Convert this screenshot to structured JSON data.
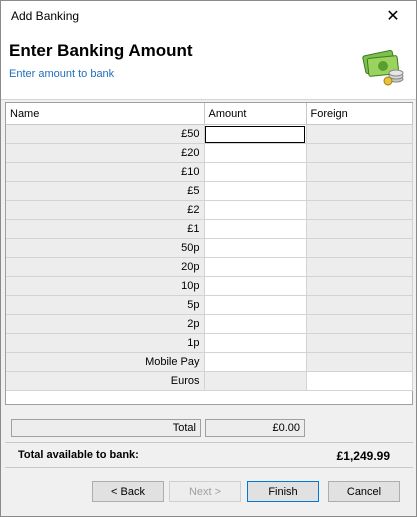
{
  "window": {
    "title": "Add Banking",
    "close_glyph": "✕"
  },
  "header": {
    "title": "Enter Banking Amount",
    "subtitle": "Enter amount to bank",
    "icon": "money-icon"
  },
  "grid": {
    "columns": [
      "Name",
      "Amount",
      "Foreign"
    ],
    "rows": [
      {
        "name": "£50",
        "amount": "",
        "foreign": ""
      },
      {
        "name": "£20",
        "amount": "",
        "foreign": ""
      },
      {
        "name": "£10",
        "amount": "",
        "foreign": ""
      },
      {
        "name": "£5",
        "amount": "",
        "foreign": ""
      },
      {
        "name": "£2",
        "amount": "",
        "foreign": ""
      },
      {
        "name": "£1",
        "amount": "",
        "foreign": ""
      },
      {
        "name": "50p",
        "amount": "",
        "foreign": ""
      },
      {
        "name": "20p",
        "amount": "",
        "foreign": ""
      },
      {
        "name": "10p",
        "amount": "",
        "foreign": ""
      },
      {
        "name": "5p",
        "amount": "",
        "foreign": ""
      },
      {
        "name": "2p",
        "amount": "",
        "foreign": ""
      },
      {
        "name": "1p",
        "amount": "",
        "foreign": ""
      },
      {
        "name": "Mobile Pay",
        "amount": "",
        "foreign": ""
      },
      {
        "name": "Euros",
        "amount": "",
        "foreign": ""
      }
    ]
  },
  "totals": {
    "label": "Total",
    "value": "£0.00"
  },
  "available": {
    "label": "Total available to bank:",
    "value": "£1,249.99"
  },
  "buttons": {
    "back": "< Back",
    "next": "Next >",
    "finish": "Finish",
    "cancel": "Cancel"
  }
}
